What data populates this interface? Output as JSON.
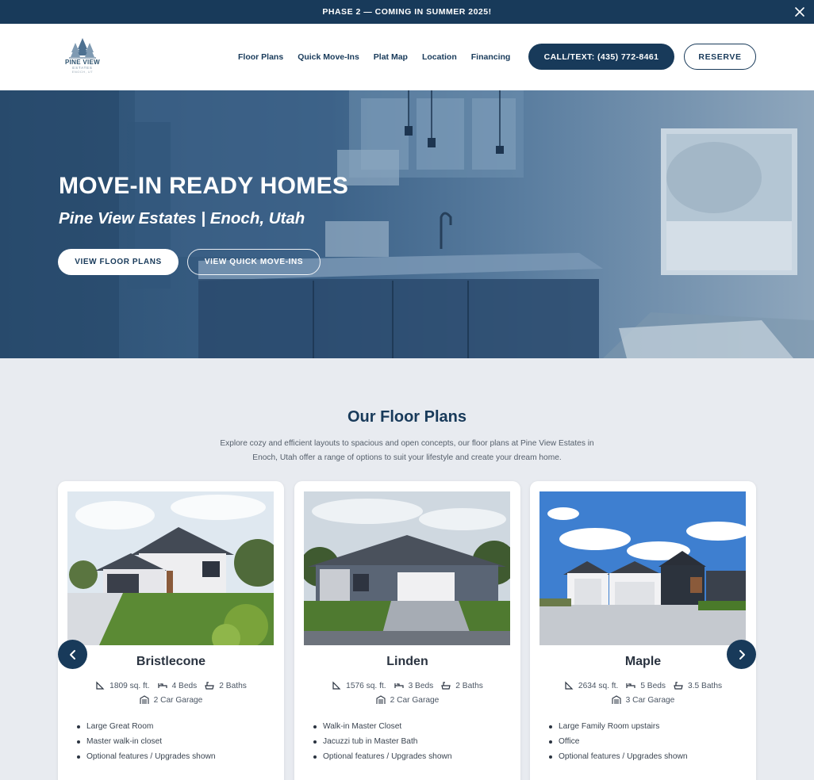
{
  "announcement": {
    "text": "PHASE 2 — COMING IN SUMMER 2025!",
    "close_icon": "close-icon"
  },
  "logo": {
    "name": "PINE VIEW",
    "sub": "ESTATES",
    "location": "ENOCH, UT"
  },
  "nav": {
    "items": [
      "Floor Plans",
      "Quick Move-Ins",
      "Plat Map",
      "Location",
      "Financing"
    ],
    "call_label": "CALL/TEXT: (435) 772-8461",
    "reserve_label": "RESERVE"
  },
  "hero": {
    "title": "MOVE-IN READY HOMES",
    "subtitle": "Pine View Estates | Enoch, Utah",
    "primary_button": "VIEW FLOOR PLANS",
    "secondary_button": "VIEW QUICK MOVE-INS"
  },
  "floor_plans": {
    "title": "Our Floor Plans",
    "description": "Explore cozy and efficient layouts to spacious and open concepts, our floor plans at Pine View Estates in Enoch, Utah offer a range of options to suit your lifestyle and create your dream home.",
    "prev_icon": "chevron-left-icon",
    "next_icon": "chevron-right-icon",
    "cards": [
      {
        "name": "Bristlecone",
        "sqft": "1809 sq. ft.",
        "beds": "4 Beds",
        "baths": "2 Baths",
        "garage": "2 Car Garage",
        "features": [
          "Large Great Room",
          "Master walk-in closet",
          "Optional features / Upgrades shown"
        ]
      },
      {
        "name": "Linden",
        "sqft": "1576 sq. ft.",
        "beds": "3 Beds",
        "baths": "2 Baths",
        "garage": "2 Car Garage",
        "features": [
          "Walk-in Master Closet",
          "Jacuzzi tub in Master Bath",
          "Optional features / Upgrades shown"
        ]
      },
      {
        "name": "Maple",
        "sqft": "2634 sq. ft.",
        "beds": "5 Beds",
        "baths": "3.5 Baths",
        "garage": "3 Car Garage",
        "features": [
          "Large Family Room upstairs",
          "Office",
          "Optional features / Upgrades shown"
        ]
      }
    ]
  },
  "colors": {
    "navy": "#183a5a",
    "background": "#e8ebf0"
  }
}
